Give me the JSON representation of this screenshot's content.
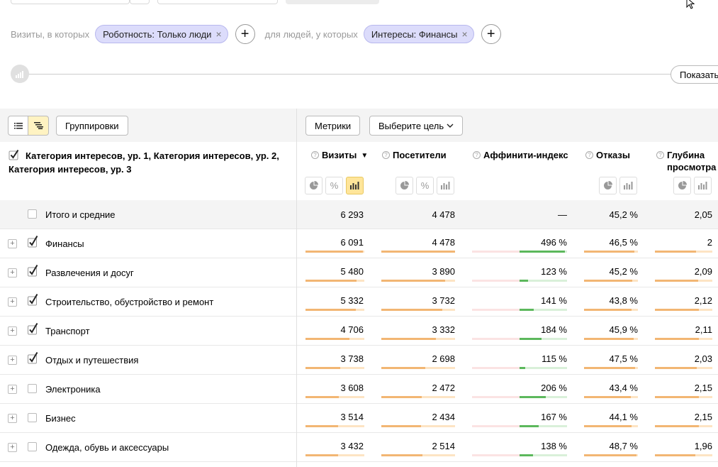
{
  "filters": {
    "visits_label": "Визиты, в которых",
    "robot_chip": "Роботность: Только люди",
    "people_label": "для людей, у которых",
    "interest_chip": "Интересы: Финансы",
    "add_symbol": "+",
    "remove_symbol": "×"
  },
  "slider": {
    "show_label": "Показать"
  },
  "toolbar": {
    "groupings_label": "Группировки",
    "metrics_label": "Метрики",
    "goal_label": "Выберите цель"
  },
  "table": {
    "dimension_title": "Категория интересов, ур. 1, Категория интересов, ур. 2, Категория интересов, ур. 3",
    "columns": {
      "visits": "Визиты",
      "visitors": "Посетители",
      "affinity": "Аффинити-индекс",
      "bounce": "Отказы",
      "depth": "Глубина просмотра"
    },
    "sort_indicator": "▼",
    "total": {
      "name": "Итого и средние",
      "visits": "6 293",
      "visitors": "4 478",
      "affinity": "—",
      "bounce": "45,2 %",
      "depth": "2,05"
    },
    "rows": [
      {
        "name": "Финансы",
        "checked": true,
        "visits": "6 091",
        "visitors": "4 478",
        "affinity": "496 %",
        "bounce": "46,5 %",
        "depth": "2",
        "visits_frac": 0.97,
        "visitors_frac": 1.0,
        "affinity_frac": 0.95,
        "bounce_frac": 0.93,
        "depth_frac": 0.72
      },
      {
        "name": "Развлечения и досуг",
        "checked": true,
        "visits": "5 480",
        "visitors": "3 890",
        "affinity": "123 %",
        "bounce": "45,2 %",
        "depth": "2,09",
        "visits_frac": 0.87,
        "visitors_frac": 0.87,
        "affinity_frac": 0.18,
        "bounce_frac": 0.9,
        "depth_frac": 0.75
      },
      {
        "name": "Строительство, обустройство и ремонт",
        "checked": true,
        "visits": "5 332",
        "visitors": "3 732",
        "affinity": "141 %",
        "bounce": "43,8 %",
        "depth": "2,12",
        "visits_frac": 0.85,
        "visitors_frac": 0.83,
        "affinity_frac": 0.3,
        "bounce_frac": 0.88,
        "depth_frac": 0.76
      },
      {
        "name": "Транспорт",
        "checked": true,
        "visits": "4 706",
        "visitors": "3 332",
        "affinity": "184 %",
        "bounce": "45,9 %",
        "depth": "2,11",
        "visits_frac": 0.75,
        "visitors_frac": 0.74,
        "affinity_frac": 0.47,
        "bounce_frac": 0.92,
        "depth_frac": 0.76
      },
      {
        "name": "Отдых и путешествия",
        "checked": true,
        "visits": "3 738",
        "visitors": "2 698",
        "affinity": "115 %",
        "bounce": "47,5 %",
        "depth": "2,03",
        "visits_frac": 0.59,
        "visitors_frac": 0.6,
        "affinity_frac": 0.12,
        "bounce_frac": 0.95,
        "depth_frac": 0.73
      },
      {
        "name": "Электроника",
        "checked": false,
        "visits": "3 608",
        "visitors": "2 472",
        "affinity": "206 %",
        "bounce": "43,4 %",
        "depth": "2,15",
        "visits_frac": 0.57,
        "visitors_frac": 0.55,
        "affinity_frac": 0.55,
        "bounce_frac": 0.87,
        "depth_frac": 0.77
      },
      {
        "name": "Бизнес",
        "checked": false,
        "visits": "3 514",
        "visitors": "2 434",
        "affinity": "167 %",
        "bounce": "44,1 %",
        "depth": "2,15",
        "visits_frac": 0.56,
        "visitors_frac": 0.54,
        "affinity_frac": 0.4,
        "bounce_frac": 0.88,
        "depth_frac": 0.77
      },
      {
        "name": "Одежда, обувь и аксессуары",
        "checked": false,
        "visits": "3 432",
        "visitors": "2 514",
        "affinity": "138 %",
        "bounce": "48,7 %",
        "depth": "1,96",
        "visits_frac": 0.55,
        "visitors_frac": 0.56,
        "affinity_frac": 0.28,
        "bounce_frac": 0.97,
        "depth_frac": 0.7
      }
    ]
  },
  "colors": {
    "accent_bar": "#f2b673",
    "affinity_positive": "#5cb85c",
    "chip_bg": "#dcdcfb",
    "active_toggle": "#ffe59a"
  },
  "icons": [
    "pie-icon",
    "percent-icon",
    "bar-chart-icon",
    "list-icon",
    "tree-icon",
    "close-icon",
    "plus-icon",
    "help-icon",
    "expand-icon",
    "checkbox-icon",
    "cursor-icon"
  ]
}
